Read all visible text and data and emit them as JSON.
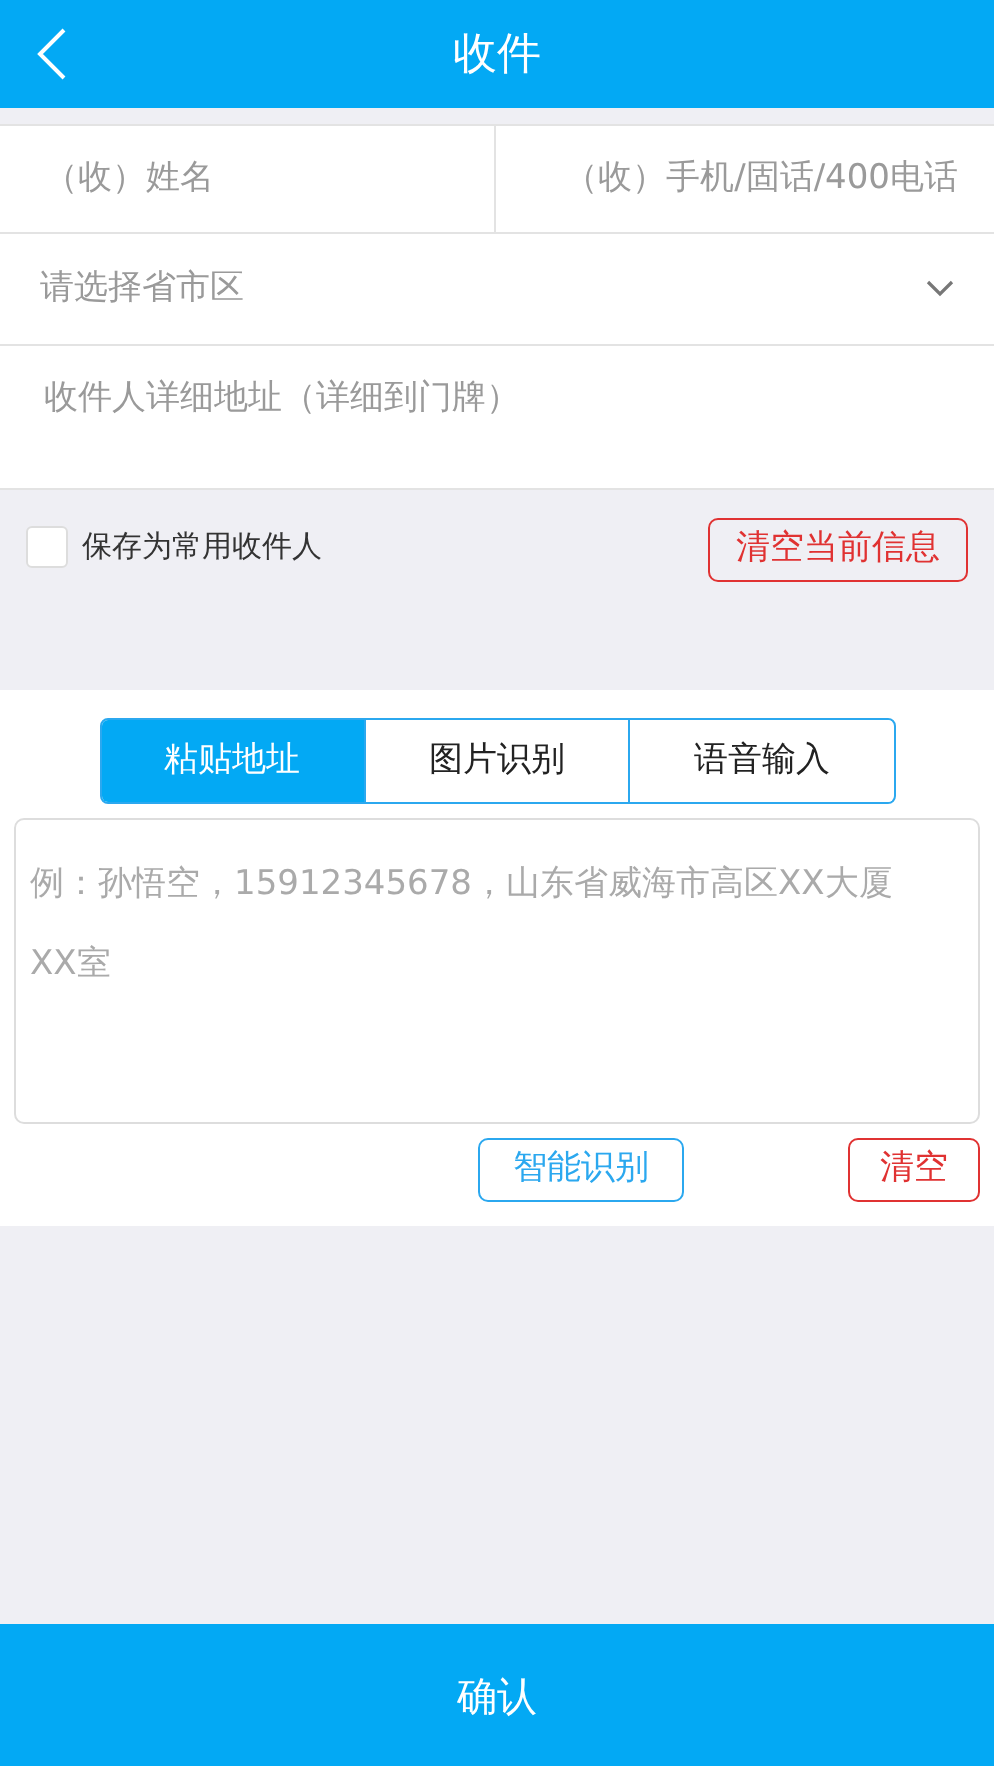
{
  "header": {
    "title": "收件"
  },
  "form": {
    "name": {
      "placeholder": "（收）姓名"
    },
    "phone": {
      "placeholder": "（收）手机/固话/400电话"
    },
    "region": {
      "placeholder": "请选择省市区"
    },
    "address": {
      "placeholder": "收件人详细地址（详细到门牌）"
    }
  },
  "save_contact": {
    "label": "保存为常用收件人",
    "checked": false
  },
  "clear_info_button": "清空当前信息",
  "tabs": [
    {
      "label": "粘贴地址",
      "selected": true
    },
    {
      "label": "图片识别",
      "selected": false
    },
    {
      "label": "语音输入",
      "selected": false
    }
  ],
  "paste_box": {
    "placeholder": "例：孙悟空，15912345678，山东省威海市高区XX大厦XX室"
  },
  "recognize_button": "智能识别",
  "clear_button": "清空",
  "confirm_button": "确认"
}
